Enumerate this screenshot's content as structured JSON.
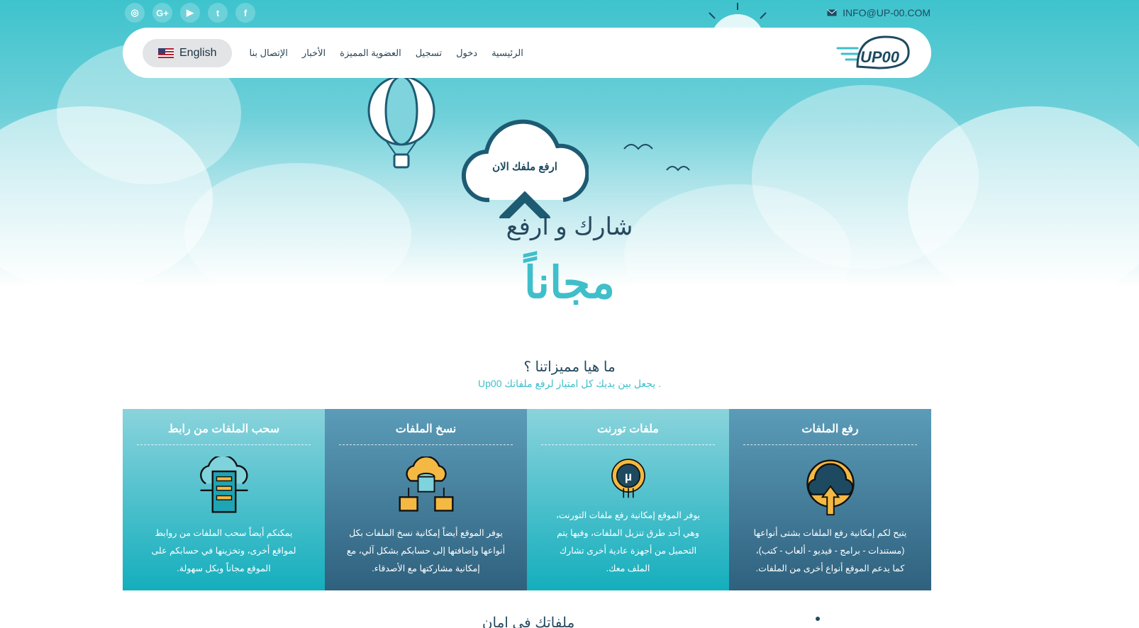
{
  "topbar": {
    "social": [
      {
        "name": "instagram",
        "glyph": "◎"
      },
      {
        "name": "google-plus",
        "glyph": "G+"
      },
      {
        "name": "youtube",
        "glyph": "▶"
      },
      {
        "name": "twitter",
        "glyph": "t"
      },
      {
        "name": "facebook",
        "glyph": "f"
      }
    ],
    "email": "INFO@UP-00.COM"
  },
  "navbar": {
    "language_label": "English",
    "links": [
      "الرئيسية",
      "دخول",
      "تسجيل",
      "العضوية المميزة",
      "الأخبار",
      "الإتصال بنا"
    ],
    "logo_text": "UP00"
  },
  "hero": {
    "upload_cloud_label": "ارفع ملفك الان",
    "title": "شارك و ارفع",
    "free_label": "مجاناً"
  },
  "features": {
    "title": "ما هيا مميزاتنا ؟",
    "subtitle": "Up00 يجعل بين يديك كل امتياز لرفع ملفاتك ."
  },
  "cards": [
    {
      "title": "سحب الملفات من رابط",
      "text": "يمكنكم أيضاً سحب الملفات من روابط لمواقع أخرى، وتخزينها في حسابكم على الموقع مجاناً وبكل سهولة."
    },
    {
      "title": "نسخ الملفات",
      "text": "يوفر الموقع أيضاً إمكانية نسخ الملفات بكل أنواعها وإضافتها إلى حسابكم بشكل آلي، مع إمكانية مشاركتها مع الأصدقاء."
    },
    {
      "title": "ملفات تورنت",
      "text": "يوفر الموقع إمكانية رفع ملفات التورنت، وهي أحد طرق تنزيل الملفات، وفيها يتم التحميل من أجهزة عادية أخرى تشارك الملف معك."
    },
    {
      "title": "رفع الملفات",
      "text": "يتيح لكم إمكانية رفع الملفات بشتى أنواعها (مستندات - برامج - فيديو - ألعاب - كتب)، كما يدعم الموقع أنواع أخرى من الملفات."
    }
  ],
  "bottom": {
    "title": "ملفاتك في امان"
  },
  "colors": {
    "accent": "#3fbfca",
    "dark_text": "#26495f",
    "card_teal": "#14aebd",
    "card_dark": "#2f617e",
    "icon_gold": "#f4b942"
  }
}
